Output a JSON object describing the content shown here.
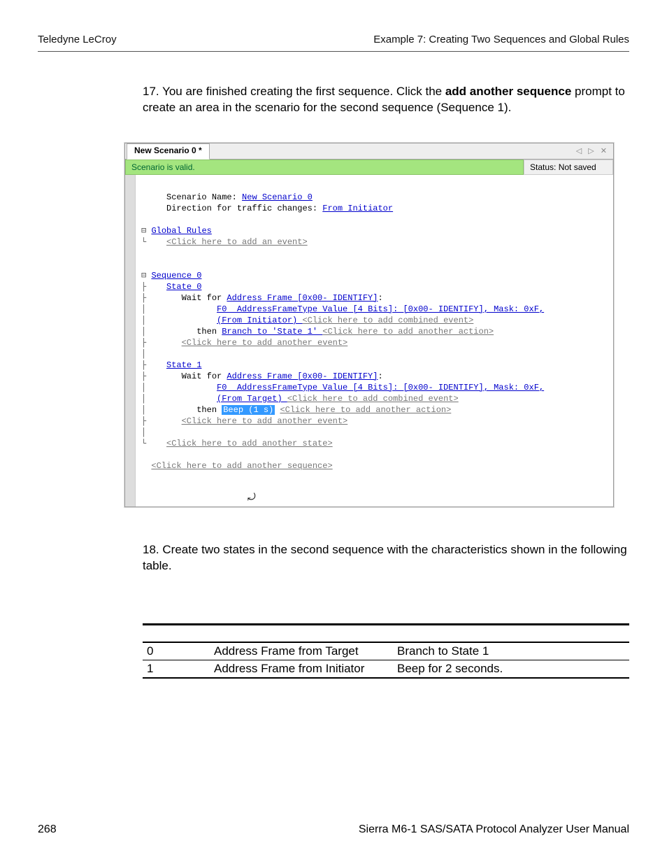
{
  "header": {
    "left": "Teledyne LeCroy",
    "right": "Example 7: Creating Two Sequences and Global Rules"
  },
  "step17": {
    "num": "17.",
    "text_a": "You are finished creating the first sequence. Click the ",
    "bold": "add another sequence",
    "text_b": " prompt to create an area in the scenario for the second sequence (Sequence 1)."
  },
  "screenshot": {
    "tab_title": "New Scenario 0 *",
    "tab_controls": "◁  ▷  ✕",
    "status_valid": "Scenario is valid.",
    "status_right": "Status: Not saved",
    "line_scen_name_label": "Scenario Name: ",
    "line_scen_name_value": "New Scenario 0",
    "line_dir_label": "Direction for traffic changes: ",
    "line_dir_value": "From Initiator",
    "global_rules": "Global Rules",
    "add_event": "<Click here to add an event>",
    "seq0": "Sequence 0",
    "state0": "State 0",
    "wait_for": "Wait for ",
    "addr_frame": "Address Frame [0x00- IDENTIFY]",
    "f0_line": "F0  AddressFrameType Value [4 Bits]: [0x00- IDENTIFY], Mask: 0xF,",
    "from_initiator": "(From Initiator) ",
    "add_combined": "<Click here to add combined event>",
    "then": "then ",
    "branch_state1": "Branch to 'State 1' ",
    "add_another_action": "<Click here to add another action>",
    "add_another_event": "<Click here to add another event>",
    "state1": "State 1",
    "from_target": "(From Target) ",
    "beep": "Beep (1 s)",
    "add_another_state": "<Click here to add another state>",
    "add_another_sequence": "<Click here to add another sequence>"
  },
  "step18": {
    "num": "18.",
    "text": "Create two states in the second sequence with the characteristics shown in the following table."
  },
  "table": {
    "rows": [
      {
        "c0": "0",
        "c1": "Address Frame from Target",
        "c2": "Branch to State 1"
      },
      {
        "c0": "1",
        "c1": "Address Frame from Initiator",
        "c2": "Beep for 2 seconds."
      }
    ]
  },
  "footer": {
    "page": "268",
    "title": "Sierra M6-1 SAS/SATA Protocol Analyzer User Manual"
  }
}
